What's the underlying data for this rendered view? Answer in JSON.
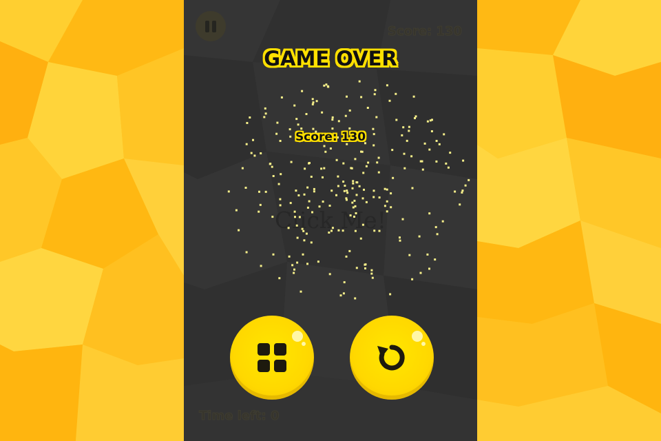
{
  "game": {
    "title": "GAME OVER",
    "score_label": "Score: 130",
    "hud_score": "Score: 130",
    "hint_text": "Click Me!",
    "time_left": "Time left: 0"
  },
  "buttons": {
    "pause": "pause-icon",
    "menu": "grid-menu-icon",
    "restart": "restart-icon"
  },
  "colors": {
    "background_side": "#ffc21a",
    "stage": "#323232",
    "accent_yellow": "#ffe000",
    "particle": "#f6ef8a"
  }
}
